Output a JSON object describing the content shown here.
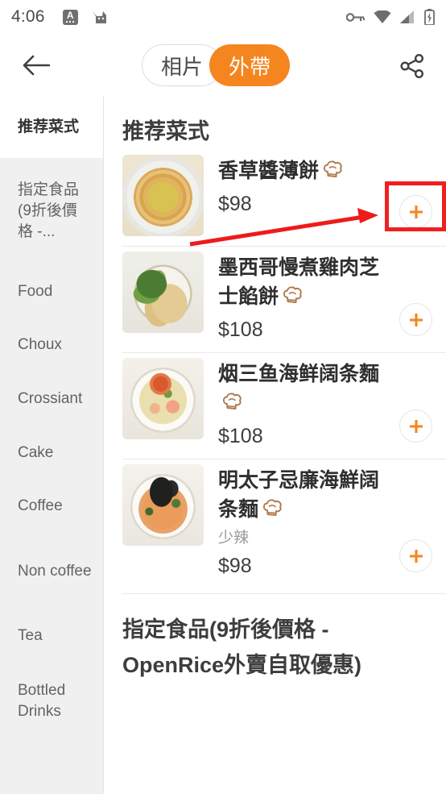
{
  "status_bar": {
    "clock": "4:06",
    "left_icons": [
      "app-notification-icon",
      "cat-notification-icon"
    ],
    "right_icons": [
      "vpn-key-icon",
      "wifi-icon",
      "cellular-signal-icon",
      "battery-charging-icon"
    ]
  },
  "top_bar": {
    "back_icon": "back-arrow-icon",
    "share_icon": "share-icon",
    "tabs": [
      {
        "label": "相片",
        "active": false
      },
      {
        "label": "外帶",
        "active": true
      }
    ],
    "active_color": "#F5851F"
  },
  "sidebar": {
    "items": [
      {
        "label": "推荐菜式",
        "selected": true
      },
      {
        "label": "指定食品(9折後價格 -...",
        "selected": false
      },
      {
        "label": "Food",
        "selected": false
      },
      {
        "label": "Choux",
        "selected": false
      },
      {
        "label": "Crossiant",
        "selected": false
      },
      {
        "label": "Cake",
        "selected": false
      },
      {
        "label": "Coffee",
        "selected": false
      },
      {
        "label": "Non coffee",
        "selected": false
      },
      {
        "label": "Tea",
        "selected": false
      },
      {
        "label": "Bottled Drinks",
        "selected": false
      }
    ]
  },
  "main": {
    "header": "推荐菜式",
    "dishes": [
      {
        "name": "香草醬薄餅",
        "recommended_icon": "chef-hat-icon",
        "note": "",
        "price": "$98",
        "add_icon": "plus-icon",
        "photo": "pizza-photo"
      },
      {
        "name": "墨西哥慢煮雞肉芝士餡餅",
        "recommended_icon": "chef-hat-icon",
        "note": "",
        "price": "$108",
        "add_icon": "plus-icon",
        "photo": "quesadilla-photo"
      },
      {
        "name": "烟三鱼海鲜阔条麵",
        "recommended_icon": "chef-hat-icon",
        "note": "",
        "price": "$108",
        "add_icon": "plus-icon",
        "photo": "salmon-pasta-photo"
      },
      {
        "name": "明太子忌廉海鮮阔条麵",
        "recommended_icon": "chef-hat-icon",
        "note": "少辣",
        "price": "$98",
        "add_icon": "plus-icon",
        "photo": "mentaiko-pasta-photo"
      }
    ],
    "next_section_title": "指定食品(9折後價格 - OpenRice外賣自取優惠)"
  },
  "annotation": {
    "highlight_target": "add-to-cart-button-first-dish",
    "box_color": "#ef2020",
    "arrow_color": "#ee1b1b"
  }
}
